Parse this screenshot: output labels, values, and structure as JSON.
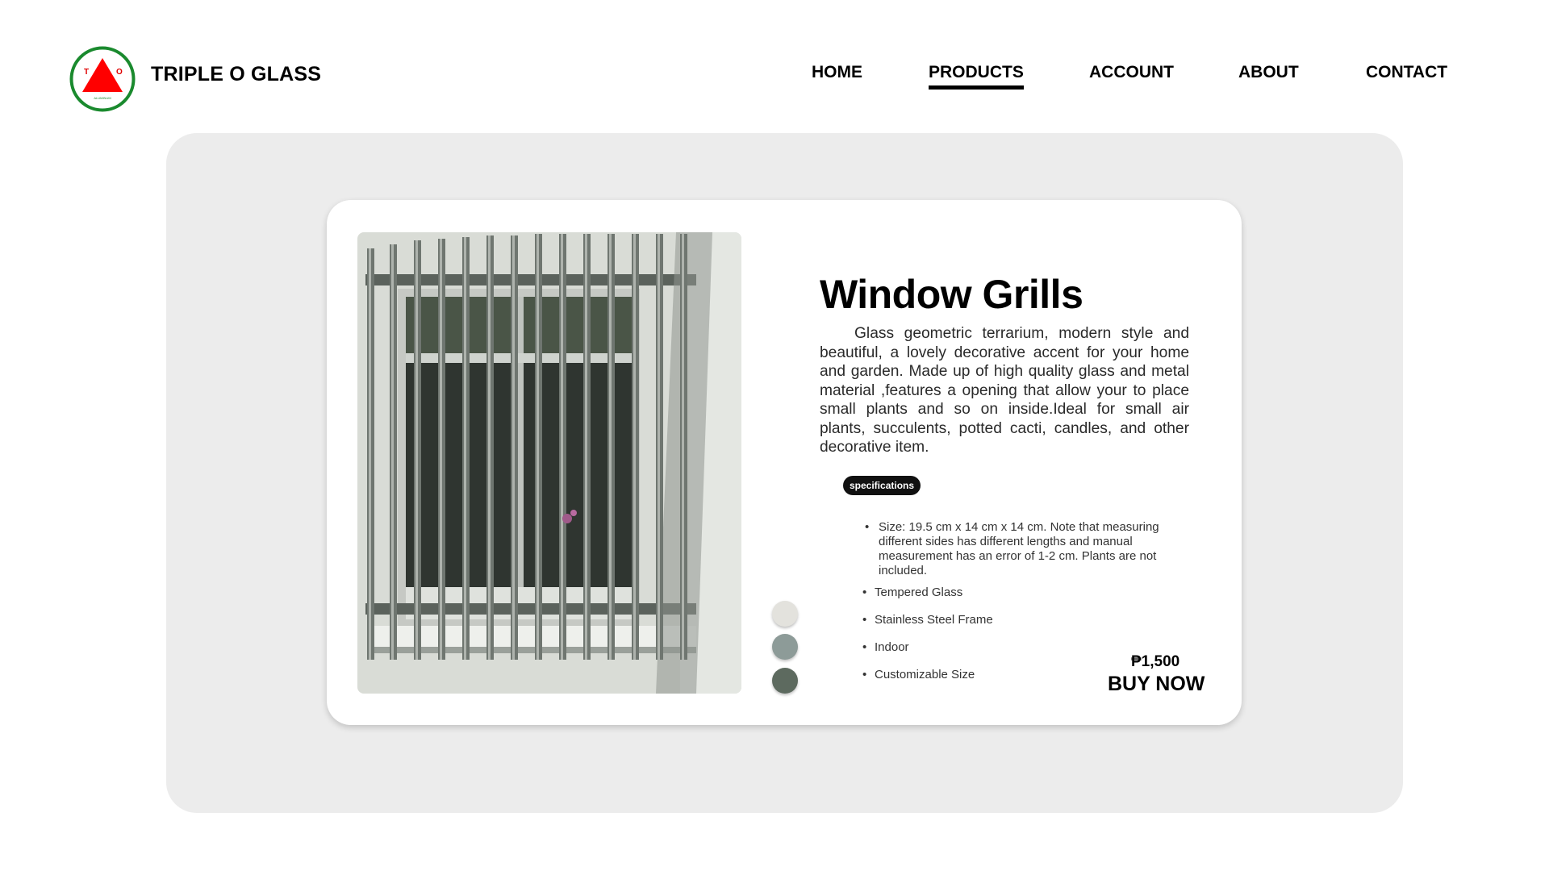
{
  "header": {
    "brand": "TRIPLE O GLASS",
    "logo": {
      "letters": [
        "T",
        "O"
      ],
      "subtext": "ALUMINUM",
      "ring_color": "#1a8a2e",
      "triangle_color": "#ff0000"
    },
    "nav": [
      {
        "label": "HOME",
        "active": false
      },
      {
        "label": "PRODUCTS",
        "active": true
      },
      {
        "label": "ACCOUNT",
        "active": false
      },
      {
        "label": "ABOUT",
        "active": false
      },
      {
        "label": "CONTACT",
        "active": false
      }
    ]
  },
  "product": {
    "title": "Window Grills",
    "description": "Glass geometric terrarium, modern style and beautiful, a lovely decorative accent for your home and garden. Made up of high quality glass and metal material ,features a opening that allow your to place small plants and so on inside.Ideal for small air plants, succulents, potted cacti, candles, and other decorative item.",
    "spec_badge": "specifications",
    "specs": [
      "Size: 19.5 cm x 14 cm x 14 cm. Note that measuring different sides has different lengths and manual measurement has an error of 1-2 cm. Plants are not included.",
      "Tempered Glass",
      "Stainless Steel Frame",
      "Indoor",
      "Customizable Size"
    ],
    "swatches": [
      "#e3e2dd",
      "#8d9b98",
      "#5d6a5f"
    ],
    "price": "₱1,500",
    "buy_label": "BUY NOW"
  }
}
